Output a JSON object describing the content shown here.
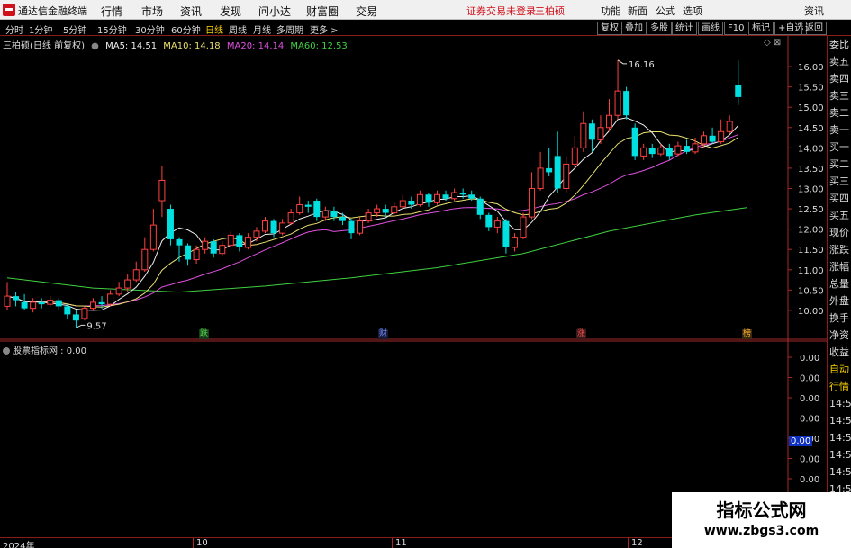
{
  "app": {
    "title": "通达信金融终端",
    "menus": [
      "行情",
      "市场",
      "资讯",
      "发现",
      "问小达",
      "财富圈",
      "交易"
    ],
    "warning": "证券交易未登录",
    "stock_name_top": "三柏硕",
    "right_buttons": [
      "功能",
      "新面",
      "公式",
      "选项",
      "资讯"
    ]
  },
  "periods": {
    "items": [
      "分时",
      "1分钟",
      "5分钟",
      "15分钟",
      "30分钟",
      "60分钟",
      "日线",
      "周线",
      "月线",
      "多周期",
      "更多 >"
    ],
    "active": "日线"
  },
  "toolbar_right": [
    "复权",
    "叠加",
    "多股",
    "统计",
    "画线",
    "F10",
    "标记",
    "+自选",
    "返回"
  ],
  "info": {
    "stock": "三柏硕(日线 前复权)",
    "ma5": "MA5: 14.51",
    "ma10": "MA10: 14.18",
    "ma20": "MA20: 14.14",
    "ma60": "MA60: 12.53"
  },
  "colors": {
    "up": "#ff4040",
    "down": "#00e0e0",
    "ma5": "#f0f0f0",
    "ma10": "#e8e070",
    "ma20": "#e050e0",
    "ma60": "#40d040",
    "axis": "#a52a2a"
  },
  "right_panel": [
    "委比",
    "卖五",
    "卖四",
    "卖三",
    "卖二",
    "卖一",
    "买一",
    "买二",
    "买三",
    "买四",
    "买五",
    "现价",
    "涨跌",
    "涨幅",
    "总量",
    "外盘",
    "换手",
    "净资",
    "收益",
    "自动",
    "行情",
    "14:5",
    "14:5",
    "14:5",
    "14:5",
    "14:5",
    "14:5",
    "14:5",
    "14:5",
    "14:5",
    "14:5"
  ],
  "price_axis": [
    "16.00",
    "15.50",
    "15.00",
    "14.50",
    "14.00",
    "13.50",
    "13.00",
    "12.50",
    "12.00",
    "11.50",
    "11.00",
    "10.50",
    "10.00"
  ],
  "sub_axis": [
    "0.00",
    "0.00",
    "0.00",
    "0.00",
    "0.00",
    "0.00",
    "0.00",
    "0.00"
  ],
  "sub_current": "0.00",
  "sub_info": "股票指标网 : 0.00",
  "annotations": {
    "high": "16.16",
    "low": "9.57",
    "events": [
      "跌",
      "财",
      "涨",
      "榜"
    ]
  },
  "time_axis": [
    "2024年",
    "10",
    "11",
    "12"
  ],
  "watermark": {
    "line1": "指标公式网",
    "line2": "www.zbgs3.com"
  },
  "chart_data": {
    "type": "candlestick",
    "candles": [
      {
        "o": 10.1,
        "c": 10.35,
        "h": 10.7,
        "l": 10.0
      },
      {
        "o": 10.35,
        "c": 10.25,
        "h": 10.45,
        "l": 10.1
      },
      {
        "o": 10.2,
        "c": 10.05,
        "h": 10.4,
        "l": 10.0
      },
      {
        "o": 10.05,
        "c": 10.2,
        "h": 10.3,
        "l": 9.95
      },
      {
        "o": 10.2,
        "c": 10.15,
        "h": 10.3,
        "l": 10.05
      },
      {
        "o": 10.15,
        "c": 10.25,
        "h": 10.35,
        "l": 10.1
      },
      {
        "o": 10.25,
        "c": 10.1,
        "h": 10.3,
        "l": 10.0
      },
      {
        "o": 10.1,
        "c": 9.9,
        "h": 10.15,
        "l": 9.8
      },
      {
        "o": 9.9,
        "c": 9.75,
        "h": 10.0,
        "l": 9.57
      },
      {
        "o": 9.8,
        "c": 10.05,
        "h": 10.1,
        "l": 9.75
      },
      {
        "o": 10.05,
        "c": 10.2,
        "h": 10.3,
        "l": 10.0
      },
      {
        "o": 10.2,
        "c": 10.15,
        "h": 10.35,
        "l": 10.05
      },
      {
        "o": 10.15,
        "c": 10.4,
        "h": 10.5,
        "l": 10.1
      },
      {
        "o": 10.4,
        "c": 10.55,
        "h": 10.7,
        "l": 10.35
      },
      {
        "o": 10.55,
        "c": 10.75,
        "h": 10.9,
        "l": 10.45
      },
      {
        "o": 10.75,
        "c": 11.0,
        "h": 11.2,
        "l": 10.7
      },
      {
        "o": 11.0,
        "c": 11.5,
        "h": 11.8,
        "l": 10.95
      },
      {
        "o": 11.5,
        "c": 12.1,
        "h": 12.5,
        "l": 11.45
      },
      {
        "o": 12.7,
        "c": 13.2,
        "h": 13.55,
        "l": 12.3
      },
      {
        "o": 12.5,
        "c": 11.75,
        "h": 12.6,
        "l": 11.6
      },
      {
        "o": 11.75,
        "c": 11.6,
        "h": 11.8,
        "l": 11.2
      },
      {
        "o": 11.6,
        "c": 11.25,
        "h": 11.65,
        "l": 11.1
      },
      {
        "o": 11.25,
        "c": 11.5,
        "h": 11.6,
        "l": 11.15
      },
      {
        "o": 11.5,
        "c": 11.7,
        "h": 11.8,
        "l": 11.4
      },
      {
        "o": 11.7,
        "c": 11.4,
        "h": 11.75,
        "l": 11.3
      },
      {
        "o": 11.4,
        "c": 11.6,
        "h": 11.7,
        "l": 11.35
      },
      {
        "o": 11.6,
        "c": 11.85,
        "h": 11.95,
        "l": 11.55
      },
      {
        "o": 11.85,
        "c": 11.55,
        "h": 11.9,
        "l": 11.45
      },
      {
        "o": 11.55,
        "c": 11.8,
        "h": 11.9,
        "l": 11.5
      },
      {
        "o": 11.8,
        "c": 11.95,
        "h": 12.05,
        "l": 11.7
      },
      {
        "o": 11.95,
        "c": 12.2,
        "h": 12.3,
        "l": 11.9
      },
      {
        "o": 12.2,
        "c": 11.9,
        "h": 12.25,
        "l": 11.8
      },
      {
        "o": 11.9,
        "c": 12.15,
        "h": 12.25,
        "l": 11.85
      },
      {
        "o": 12.15,
        "c": 12.4,
        "h": 12.5,
        "l": 12.1
      },
      {
        "o": 12.4,
        "c": 12.6,
        "h": 12.8,
        "l": 12.35
      },
      {
        "o": 12.6,
        "c": 12.55,
        "h": 12.7,
        "l": 12.4
      },
      {
        "o": 12.7,
        "c": 12.3,
        "h": 12.75,
        "l": 12.2
      },
      {
        "o": 12.3,
        "c": 12.45,
        "h": 12.55,
        "l": 12.2
      },
      {
        "o": 12.45,
        "c": 12.3,
        "h": 12.55,
        "l": 12.2
      },
      {
        "o": 12.3,
        "c": 12.2,
        "h": 12.4,
        "l": 12.1
      },
      {
        "o": 12.2,
        "c": 11.9,
        "h": 12.25,
        "l": 11.75
      },
      {
        "o": 11.9,
        "c": 12.2,
        "h": 12.3,
        "l": 11.85
      },
      {
        "o": 12.2,
        "c": 12.4,
        "h": 12.5,
        "l": 12.15
      },
      {
        "o": 12.4,
        "c": 12.5,
        "h": 12.6,
        "l": 12.3
      },
      {
        "o": 12.5,
        "c": 12.4,
        "h": 12.6,
        "l": 12.3
      },
      {
        "o": 12.4,
        "c": 12.55,
        "h": 12.65,
        "l": 12.35
      },
      {
        "o": 12.55,
        "c": 12.7,
        "h": 12.85,
        "l": 12.5
      },
      {
        "o": 12.7,
        "c": 12.6,
        "h": 12.8,
        "l": 12.5
      },
      {
        "o": 12.6,
        "c": 12.85,
        "h": 12.95,
        "l": 12.55
      },
      {
        "o": 12.85,
        "c": 12.65,
        "h": 12.9,
        "l": 12.55
      },
      {
        "o": 12.65,
        "c": 12.85,
        "h": 12.95,
        "l": 12.6
      },
      {
        "o": 12.85,
        "c": 12.75,
        "h": 12.95,
        "l": 12.7
      },
      {
        "o": 12.75,
        "c": 12.9,
        "h": 13.0,
        "l": 12.7
      },
      {
        "o": 12.9,
        "c": 12.85,
        "h": 13.0,
        "l": 12.75
      },
      {
        "o": 12.85,
        "c": 12.75,
        "h": 12.95,
        "l": 12.7
      },
      {
        "o": 12.75,
        "c": 12.35,
        "h": 12.8,
        "l": 12.25
      },
      {
        "o": 12.35,
        "c": 12.05,
        "h": 12.4,
        "l": 11.95
      },
      {
        "o": 12.05,
        "c": 12.2,
        "h": 12.3,
        "l": 11.9
      },
      {
        "o": 12.2,
        "c": 11.55,
        "h": 12.25,
        "l": 11.4
      },
      {
        "o": 11.55,
        "c": 11.8,
        "h": 11.9,
        "l": 11.45
      },
      {
        "o": 11.8,
        "c": 12.3,
        "h": 12.4,
        "l": 11.75
      },
      {
        "o": 12.3,
        "c": 13.0,
        "h": 13.4,
        "l": 12.25
      },
      {
        "o": 13.0,
        "c": 13.5,
        "h": 13.9,
        "l": 12.95
      },
      {
        "o": 13.5,
        "c": 13.4,
        "h": 14.0,
        "l": 13.3
      },
      {
        "o": 13.8,
        "c": 13.0,
        "h": 14.4,
        "l": 12.9
      },
      {
        "o": 13.0,
        "c": 13.6,
        "h": 13.8,
        "l": 12.9
      },
      {
        "o": 13.6,
        "c": 14.0,
        "h": 14.3,
        "l": 13.5
      },
      {
        "o": 14.0,
        "c": 14.6,
        "h": 14.9,
        "l": 13.9
      },
      {
        "o": 14.6,
        "c": 14.2,
        "h": 14.7,
        "l": 13.9
      },
      {
        "o": 14.2,
        "c": 14.5,
        "h": 14.8,
        "l": 14.1
      },
      {
        "o": 14.5,
        "c": 14.8,
        "h": 15.2,
        "l": 14.4
      },
      {
        "o": 14.8,
        "c": 15.4,
        "h": 16.16,
        "l": 14.7
      },
      {
        "o": 15.4,
        "c": 14.8,
        "h": 15.5,
        "l": 14.7
      },
      {
        "o": 14.5,
        "c": 13.8,
        "h": 14.6,
        "l": 13.7
      },
      {
        "o": 13.8,
        "c": 14.0,
        "h": 14.1,
        "l": 13.7
      },
      {
        "o": 14.0,
        "c": 13.85,
        "h": 14.1,
        "l": 13.75
      },
      {
        "o": 13.85,
        "c": 14.0,
        "h": 14.1,
        "l": 13.8
      },
      {
        "o": 14.0,
        "c": 13.8,
        "h": 14.1,
        "l": 13.7
      },
      {
        "o": 13.85,
        "c": 14.05,
        "h": 14.15,
        "l": 13.8
      },
      {
        "o": 14.05,
        "c": 13.9,
        "h": 14.2,
        "l": 13.85
      },
      {
        "o": 13.9,
        "c": 14.1,
        "h": 14.25,
        "l": 13.85
      },
      {
        "o": 14.1,
        "c": 14.3,
        "h": 14.4,
        "l": 14.0
      },
      {
        "o": 14.3,
        "c": 14.15,
        "h": 14.5,
        "l": 14.1
      },
      {
        "o": 14.15,
        "c": 14.4,
        "h": 14.7,
        "l": 14.1
      },
      {
        "o": 14.4,
        "c": 14.65,
        "h": 14.8,
        "l": 14.35
      },
      {
        "o": 15.55,
        "c": 15.25,
        "h": 16.15,
        "l": 15.05
      }
    ],
    "ylim": [
      9.4,
      16.4
    ],
    "y_ticks": [
      16.0,
      15.5,
      15.0,
      14.5,
      14.0,
      13.5,
      13.0,
      12.5,
      12.0,
      11.5,
      11.0,
      10.5,
      10.0
    ],
    "ma60": [
      [
        0,
        10.8
      ],
      [
        10,
        10.55
      ],
      [
        20,
        10.45
      ],
      [
        30,
        10.6
      ],
      [
        40,
        10.8
      ],
      [
        50,
        11.05
      ],
      [
        60,
        11.4
      ],
      [
        70,
        11.95
      ],
      [
        80,
        12.35
      ],
      [
        86,
        12.53
      ]
    ]
  }
}
